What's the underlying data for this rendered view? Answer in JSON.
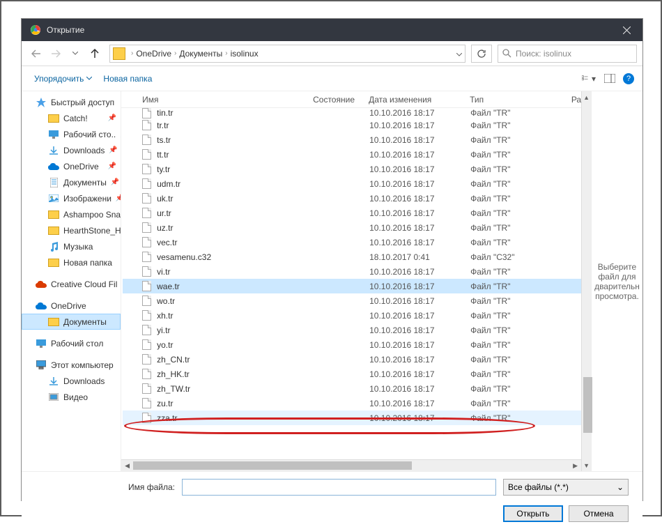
{
  "window": {
    "title": "Открытие"
  },
  "breadcrumb": [
    "OneDrive",
    "Документы",
    "isolinux"
  ],
  "search": {
    "placeholder": "Поиск: isolinux"
  },
  "toolbar": {
    "organize": "Упорядочить",
    "new_folder": "Новая папка"
  },
  "columns": {
    "name": "Имя",
    "state": "Состояние",
    "date": "Дата изменения",
    "type": "Тип",
    "size": "Ра"
  },
  "sidebar": {
    "quick_access": "Быстрый доступ",
    "onedrive": "OneDrive",
    "this_pc": "Этот компьютер",
    "items": [
      "Catch!",
      "Рабочий сто..",
      "Downloads",
      "OneDrive",
      "Документы",
      "Изображени",
      "Ashampoo Snap",
      "HearthStone_He",
      "Музыка",
      "Новая папка",
      "Creative Cloud Fil",
      "Документы",
      "Рабочий стол",
      "Downloads",
      "Видео"
    ]
  },
  "files": [
    {
      "name": "tin.tr",
      "date": "10.10.2016 18:17",
      "type": "Файл \"TR\"",
      "partial": true
    },
    {
      "name": "tr.tr",
      "date": "10.10.2016 18:17",
      "type": "Файл \"TR\""
    },
    {
      "name": "ts.tr",
      "date": "10.10.2016 18:17",
      "type": "Файл \"TR\""
    },
    {
      "name": "tt.tr",
      "date": "10.10.2016 18:17",
      "type": "Файл \"TR\""
    },
    {
      "name": "ty.tr",
      "date": "10.10.2016 18:17",
      "type": "Файл \"TR\""
    },
    {
      "name": "udm.tr",
      "date": "10.10.2016 18:17",
      "type": "Файл \"TR\""
    },
    {
      "name": "uk.tr",
      "date": "10.10.2016 18:17",
      "type": "Файл \"TR\""
    },
    {
      "name": "ur.tr",
      "date": "10.10.2016 18:17",
      "type": "Файл \"TR\""
    },
    {
      "name": "uz.tr",
      "date": "10.10.2016 18:17",
      "type": "Файл \"TR\""
    },
    {
      "name": "vec.tr",
      "date": "10.10.2016 18:17",
      "type": "Файл \"TR\""
    },
    {
      "name": "vesamenu.c32",
      "date": "18.10.2017 0:41",
      "type": "Файл \"C32\""
    },
    {
      "name": "vi.tr",
      "date": "10.10.2016 18:17",
      "type": "Файл \"TR\""
    },
    {
      "name": "wae.tr",
      "date": "10.10.2016 18:17",
      "type": "Файл \"TR\"",
      "selected": true
    },
    {
      "name": "wo.tr",
      "date": "10.10.2016 18:17",
      "type": "Файл \"TR\""
    },
    {
      "name": "xh.tr",
      "date": "10.10.2016 18:17",
      "type": "Файл \"TR\""
    },
    {
      "name": "yi.tr",
      "date": "10.10.2016 18:17",
      "type": "Файл \"TR\""
    },
    {
      "name": "yo.tr",
      "date": "10.10.2016 18:17",
      "type": "Файл \"TR\""
    },
    {
      "name": "zh_CN.tr",
      "date": "10.10.2016 18:17",
      "type": "Файл \"TR\""
    },
    {
      "name": "zh_HK.tr",
      "date": "10.10.2016 18:17",
      "type": "Файл \"TR\""
    },
    {
      "name": "zh_TW.tr",
      "date": "10.10.2016 18:17",
      "type": "Файл \"TR\""
    },
    {
      "name": "zu.tr",
      "date": "10.10.2016 18:17",
      "type": "Файл \"TR\""
    },
    {
      "name": "zza.tr",
      "date": "10.10.2016 18:17",
      "type": "Файл \"TR\"",
      "hover": true
    }
  ],
  "preview": {
    "text": "Выберите файл для дварительн просмотра."
  },
  "footer": {
    "filename_label": "Имя файла:",
    "filter": "Все файлы (*.*)",
    "open": "Открыть",
    "cancel": "Отмена"
  }
}
